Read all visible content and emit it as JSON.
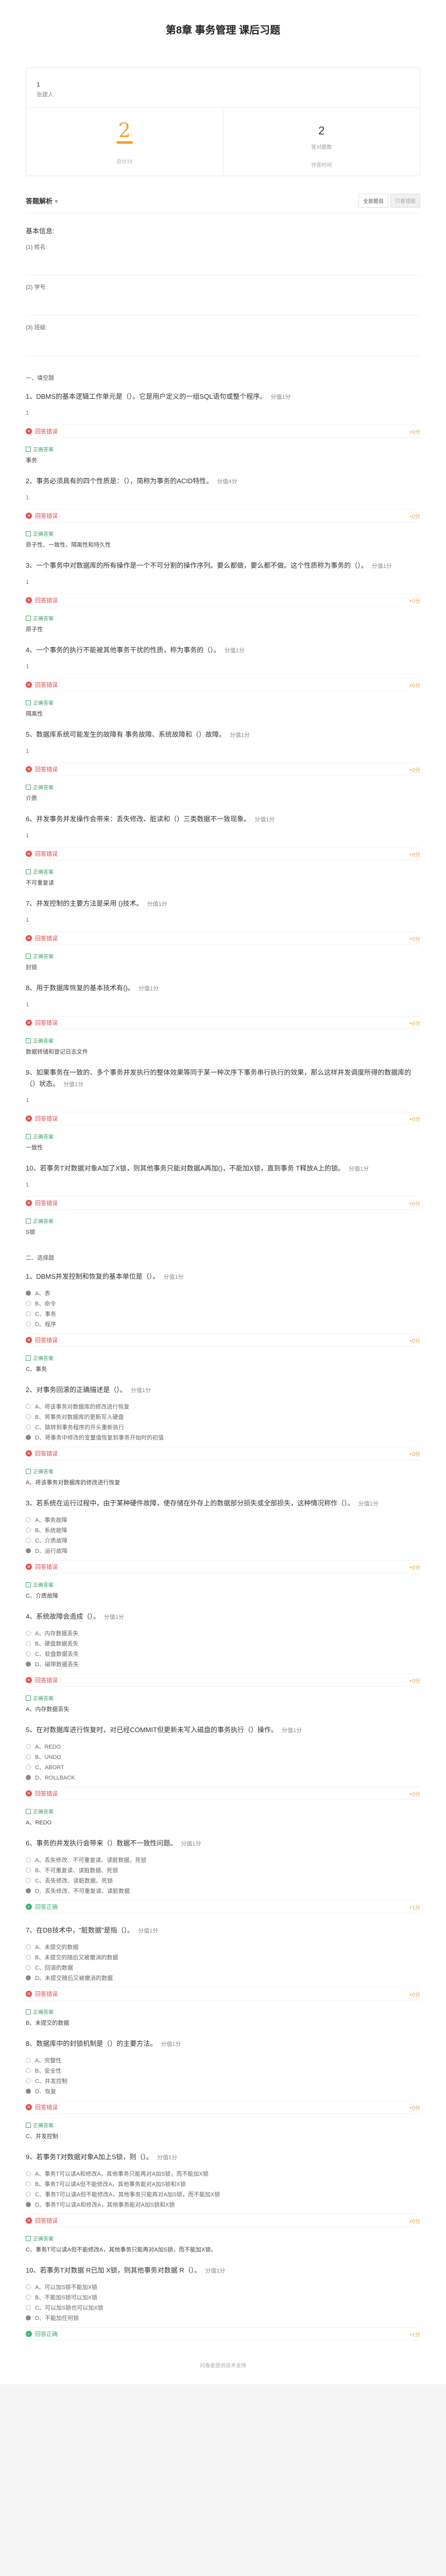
{
  "title": "第8章 事务管理 课后习题",
  "user": {
    "id": "1",
    "name": "张建人"
  },
  "stats": {
    "score": "2",
    "score_label": "总分15",
    "questions": "2",
    "questions_label": "答对题数",
    "sub": "作答时间"
  },
  "section": {
    "title": "答题解析",
    "btn_all": "全部题目",
    "btn_wrong": "只看错题"
  },
  "basic": {
    "title": "基本信息:",
    "fields": [
      "(1) 姓名:",
      "(2) 学号:",
      "(3) 班级:"
    ]
  },
  "labels": {
    "wrong": "回答错误",
    "right": "回答正确",
    "std": "正确答案",
    "pts0": "+0分",
    "pts1": "+1分"
  },
  "part1": "一、填空题",
  "fill": [
    {
      "t": "1、DBMS的基本逻辑工作单元是（）。它是用户定义的一组SQL语句或整个程序。",
      "p": "分值1分",
      "a": "1",
      "s": "事务"
    },
    {
      "t": "2、事务必须具有的四个性质是：（），简称为事务的ACID特性。",
      "p": "分值4分",
      "a": "1",
      "s": "原子性、一致性、隔离性和持久性"
    },
    {
      "t": "3、一个事务中对数据库的所有操作是一个不可分割的操作序列。要么都做，要么都不做。这个性质称为事务的（）。",
      "p": "分值1分",
      "a": "1",
      "s": "原子性"
    },
    {
      "t": "4、一个事务的执行不能被其他事务干扰的性质，称为事务的（）。",
      "p": "分值1分",
      "a": "1",
      "s": "隔离性"
    },
    {
      "t": "5、数据库系统可能发生的故障有 事务故障、系统故障和（）故障。",
      "p": "分值1分",
      "a": "1",
      "s": "介质"
    },
    {
      "t": "6、并发事务并发操作会带来：丢失修改、脏读和（）三类数据不一致现象。",
      "p": "分值1分",
      "a": "1",
      "s": "不可重复读"
    },
    {
      "t": "7、并发控制的主要方法是采用 ()技术。",
      "p": "分值1分",
      "a": "1",
      "s": "封锁"
    },
    {
      "t": "8、用于数据库恢复的基本技术有()。",
      "p": "分值1分",
      "a": "1",
      "s": "数据转储和登记日志文件"
    },
    {
      "t": "9、如果事务在一致的、多个事务并发执行的整体效果等同于某一种次序下事务串行执行的效果，那么这样并发调度所得的数据库的（）状态。",
      "p": "分值1分",
      "a": "1",
      "s": "一致性"
    },
    {
      "t": "10、若事务T对数据对象A加了X锁，则其他事务只能对数据A再加()，不能加X锁，直到事务 T释放A上的锁。",
      "p": "分值1分",
      "a": "1",
      "s": "S锁"
    }
  ],
  "part2": "二、选择题",
  "choice": [
    {
      "t": "1、DBMS并发控制和恢复的基本单位是（）。",
      "p": "分值1分",
      "o": [
        "A、表",
        "B、命令",
        "C、事务",
        "D、程序"
      ],
      "sel": 0,
      "ok": false,
      "s": "C、事务"
    },
    {
      "t": "2、对事务回滚的正确描述是（）。",
      "p": "分值1分",
      "o": [
        "A、将该事务对数据库的修改进行恢复",
        "B、将事务对数据库的更新写入硬盘",
        "C、跳转到事务程序的开头重新执行",
        "D、将事务中修改的变量值恢复到事务开始时的初值"
      ],
      "sel": 3,
      "ok": false,
      "s": "A、将该事务对数据库的修改进行恢复"
    },
    {
      "t": "3、若系统在运行过程中，由于某种硬件故障，使存储在外存上的数据部分损失或全部损失，这种情况称作（）。",
      "p": "分值1分",
      "o": [
        "A、事务故障",
        "B、系统故障",
        "C、介质故障",
        "D、运行故障"
      ],
      "sel": 3,
      "ok": false,
      "s": "C、介质故障"
    },
    {
      "t": "4、系统故障会造成（）。",
      "p": "分值1分",
      "o": [
        "A、内存数据丢失",
        "B、硬盘数据丢失",
        "C、软盘数据丢失",
        "D、磁带数据丢失"
      ],
      "sel": 3,
      "ok": false,
      "s": "A、内存数据丢失"
    },
    {
      "t": "5、在对数据库进行恢复时，对已经COMMIT但更新未写入磁盘的事务执行（）操作。",
      "p": "分值1分",
      "o": [
        "A、REDO",
        "B、UNDO",
        "C、ABORT",
        "D、ROLLBACK"
      ],
      "sel": 3,
      "ok": false,
      "s": "A、REDO"
    },
    {
      "t": "6、事务的并发执行会带来（）数据不一致性问题。",
      "p": "分值1分",
      "o": [
        "A、丢失修改、不可重复读、读脏数据、死锁",
        "B、不可重复读、读脏数据、死锁",
        "C、丢失修改、读脏数据、死锁",
        "D、丢失修改、不可重复读、读脏数据"
      ],
      "sel": 3,
      "ok": true,
      "s": ""
    },
    {
      "t": "7、在DB技术中，\"脏数据\"是指（）。",
      "p": "分值1分",
      "o": [
        "A、未提交的数据",
        "B、未提交的随后又被撤消的数据",
        "C、回滚的数据",
        "D、未提交随后又被撤消的数据"
      ],
      "sel": 3,
      "ok": false,
      "s": "B、未提交的数据"
    },
    {
      "t": "8、数据库中的封锁机制是（）的主要方法。",
      "p": "分值1分",
      "o": [
        "A、完整性",
        "B、安全性",
        "C、并发控制",
        "D、恢复"
      ],
      "sel": 3,
      "ok": false,
      "s": "C、并发控制"
    },
    {
      "t": "9、若事务T对数据对象A加上S锁，则（）。",
      "p": "分值1分",
      "o": [
        "A、事务T可以读A和修改A，其他事务只能再对A加S锁，而不能加X锁",
        "B、事务T可以读A但不能修改A，其他事务能对A加S锁和X锁",
        "C、事务T可以读A但不能修改A，其他事务只能再对A加S锁，而不能加X锁",
        "D、事务T可以读A和修改A，其他事务能对A加S锁和X锁"
      ],
      "sel": 3,
      "ok": false,
      "s": "C、事务T可以读A但不能修改A，其他事务只能再对A加S锁，而不能加X锁。"
    },
    {
      "t": "10、若事务T对数据 R已加 X锁，则其他事务对数据 R（）。",
      "p": "分值1分",
      "o": [
        "A、可以加S锁不能加X锁",
        "B、不能加S锁可以加X锁",
        "C、可以加S锁也可以加X锁",
        "D、不能加任何锁"
      ],
      "sel": 3,
      "ok": true,
      "s": ""
    }
  ],
  "footer": "问卷星提供技术支持"
}
